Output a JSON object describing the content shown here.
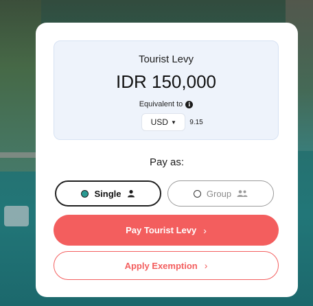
{
  "levy": {
    "title": "Tourist Levy",
    "amount": "IDR 150,000",
    "equivalent_label": "Equivalent to",
    "info_icon": "info-icon"
  },
  "currency": {
    "selected": "USD",
    "converted_value": "9.15"
  },
  "pay_as": {
    "label": "Pay as:",
    "options": [
      {
        "label": "Single",
        "icon": "person-icon",
        "selected": true
      },
      {
        "label": "Group",
        "icon": "group-icon",
        "selected": false
      }
    ]
  },
  "actions": {
    "pay_label": "Pay Tourist Levy",
    "exemption_label": "Apply Exemption",
    "chevron": "›"
  },
  "colors": {
    "accent": "#f35e5e",
    "selected_radio": "#2a9a92",
    "levy_box_bg": "#eef3fb"
  }
}
